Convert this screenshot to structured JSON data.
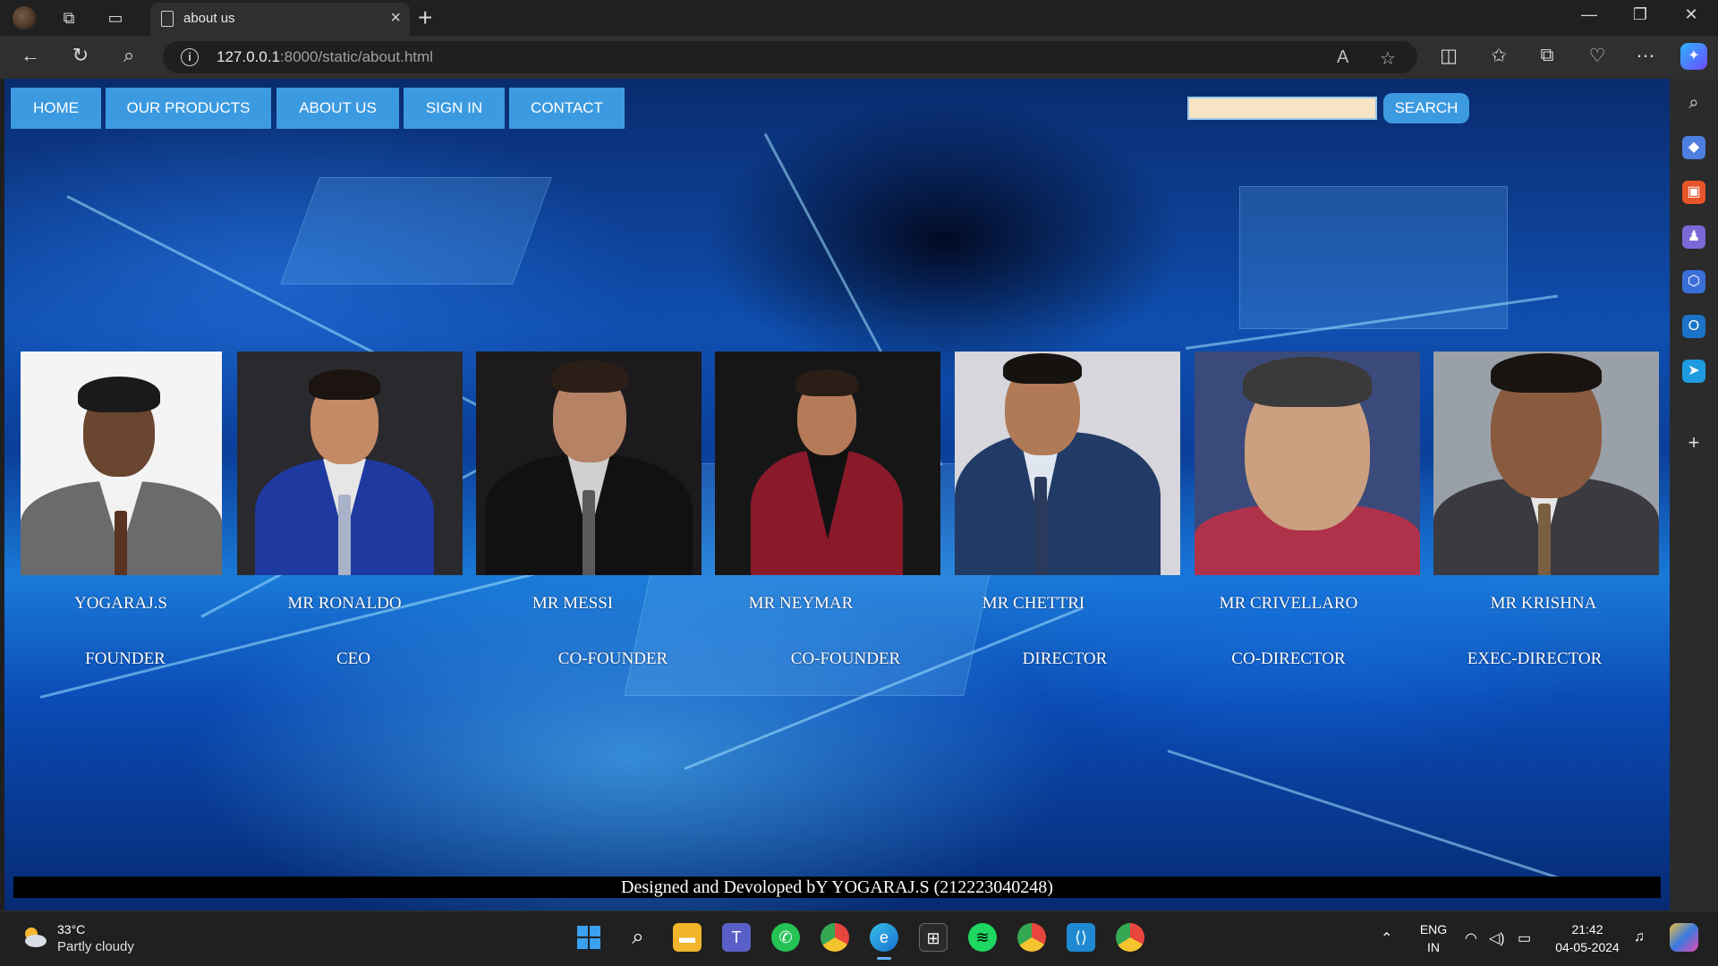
{
  "browser": {
    "tab_title": "about us",
    "url_host": "127.0.0.1",
    "url_rest": ":8000/static/about.html",
    "new_tab_glyph": "+",
    "tab_close_glyph": "×"
  },
  "nav": {
    "items": [
      "HOME",
      "OUR PRODUCTS",
      "ABOUT US",
      "SIGN IN",
      "CONTACT"
    ],
    "search_button": "SEARCH",
    "search_value": ""
  },
  "team": [
    {
      "name": "YOGARAJ.S",
      "role": "FOUNDER"
    },
    {
      "name": "MR RONALDO",
      "role": "CEO"
    },
    {
      "name": "MR MESSI",
      "role": "CO-FOUNDER"
    },
    {
      "name": "MR NEYMAR",
      "role": "CO-FOUNDER"
    },
    {
      "name": "MR CHETTRI",
      "role": "DIRECTOR"
    },
    {
      "name": "MR CRIVELLARO",
      "role": "CO-DIRECTOR"
    },
    {
      "name": "MR KRISHNA",
      "role": "EXEC-DIRECTOR"
    }
  ],
  "footer": {
    "text": "Designed and Devoloped bY YOGARAJ.S (212223040248)"
  },
  "taskbar": {
    "weather_temp": "33°C",
    "weather_desc": "Partly cloudy",
    "lang_top": "ENG",
    "lang_bottom": "IN",
    "time": "21:42",
    "date": "04-05-2024"
  },
  "colors": {
    "nav_button": "#3c9ae0",
    "search_input": "#f7e3c6",
    "footer_bar": "#000000"
  }
}
